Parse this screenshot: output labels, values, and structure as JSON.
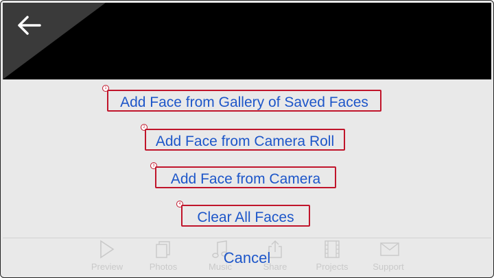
{
  "header": {
    "back_icon": "arrow-left-icon"
  },
  "options": [
    {
      "number": "1",
      "label": "Add Face from Gallery of Saved Faces"
    },
    {
      "number": "2",
      "label": "Add Face from Camera Roll"
    },
    {
      "number": "3",
      "label": "Add Face from Camera"
    },
    {
      "number": "4",
      "label": "Clear All Faces"
    }
  ],
  "tabs": [
    {
      "label": "Preview",
      "icon": "play-icon"
    },
    {
      "label": "Photos",
      "icon": "photos-icon"
    },
    {
      "label": "Music",
      "icon": "music-note-icon"
    },
    {
      "label": "Share",
      "icon": "share-icon"
    },
    {
      "label": "Projects",
      "icon": "film-icon"
    },
    {
      "label": "Support",
      "icon": "envelope-icon"
    }
  ],
  "cancel_label": "Cancel",
  "colors": {
    "link": "#1d56c9",
    "highlight": "#c0142a",
    "header": "#000000",
    "sheet": "#e9e9e9"
  }
}
